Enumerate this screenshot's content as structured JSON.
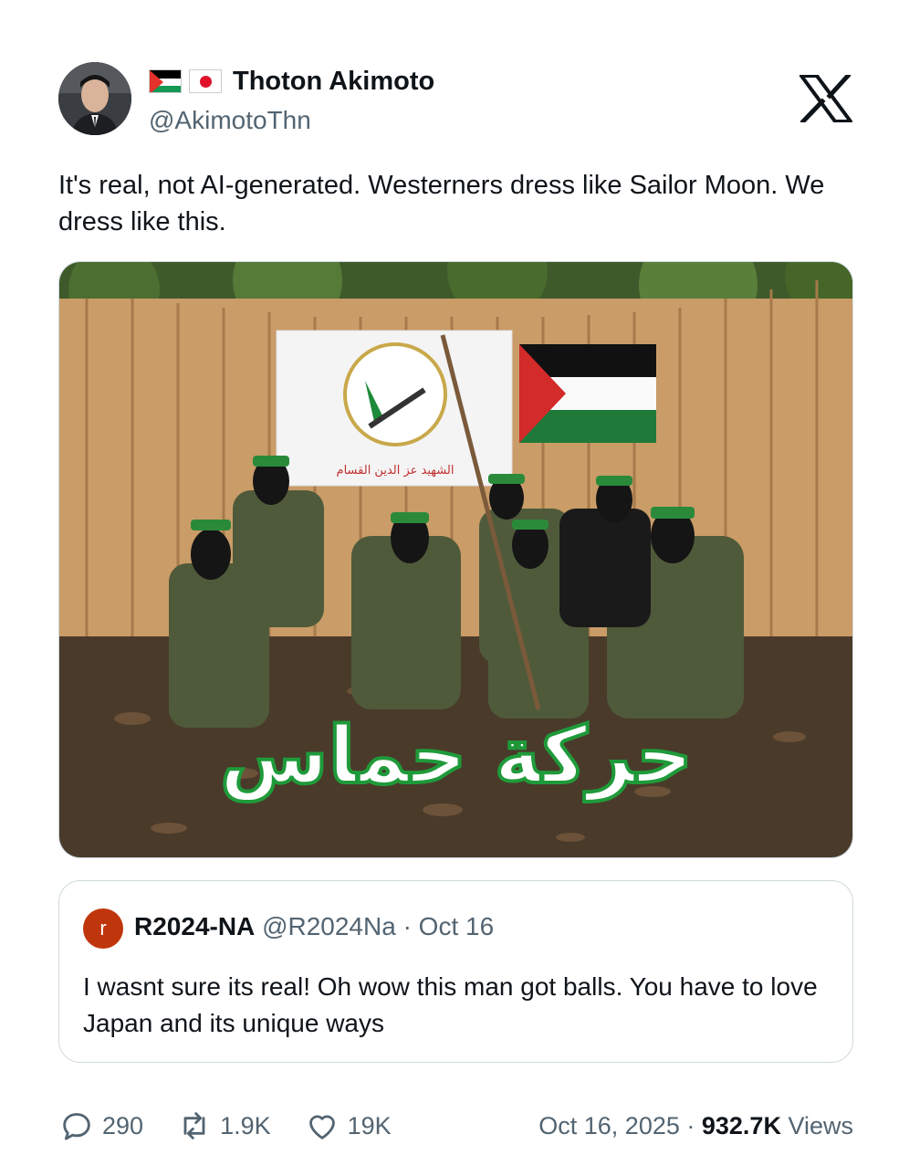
{
  "author": {
    "display_name": "Thoton Akimoto",
    "handle": "@AkimotoThn",
    "flags": [
      "palestine-flag",
      "japan-flag"
    ]
  },
  "platform": {
    "logo": "x-logo"
  },
  "tweet": {
    "text": "It's real, not AI-generated. Westerners dress like Sailor Moon. We dress like this."
  },
  "media": {
    "overlay_text": "حركة حماس",
    "banner_text": "الشهيد عز الدين القسام"
  },
  "quoted_tweet": {
    "avatar_letter": "r",
    "name": "R2024-NA",
    "meta": "@R2024Na · Oct 16",
    "text": "I wasnt sure its real! Oh wow this man got balls. You have to love Japan and its unique ways"
  },
  "actions": {
    "replies": "290",
    "reposts": "1.9K",
    "likes": "19K"
  },
  "footer": {
    "date": "Oct 16, 2025 · ",
    "views_count": "932.7K",
    "views_label": " Views"
  },
  "colors": {
    "text": "#0f1419",
    "secondary": "#536471",
    "border": "#cfd9de",
    "quote_avatar": "#c0360c"
  }
}
